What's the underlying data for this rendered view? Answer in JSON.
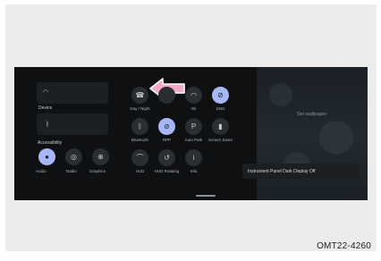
{
  "screen": {
    "left_tiles": [
      {
        "label": "",
        "icon": "wifi-icon"
      },
      {
        "label": "Device",
        "icon": "bluetooth-icon"
      }
    ],
    "section_label": "Accessibility",
    "bottom_row": [
      {
        "label": "Audio",
        "icon": "mic-icon",
        "active": true
      },
      {
        "label": "Radio",
        "icon": "radio-icon",
        "active": false
      },
      {
        "label": "Graphics",
        "icon": "game-icon",
        "active": false
      }
    ],
    "quick_grid": [
      {
        "label": "Day / Night",
        "icon": "phone-icon",
        "active": false
      },
      {
        "label": "",
        "icon": "blank-icon",
        "active": false
      },
      {
        "label": "Wi",
        "icon": "wifi-icon",
        "active": false
      },
      {
        "label": "DND",
        "icon": "dnd-icon",
        "active": true
      },
      {
        "label": "Bluetooth",
        "icon": "bluetooth-icon",
        "active": false
      },
      {
        "label": "RPP",
        "icon": "dnd-icon",
        "active": true
      },
      {
        "label": "Auto Park",
        "icon": "park-icon",
        "active": false
      },
      {
        "label": "Screen Saver",
        "icon": "lock-icon",
        "active": false
      },
      {
        "label": "HUD",
        "icon": "hud-icon",
        "active": false
      },
      {
        "label": "HUD Rotating",
        "icon": "hud-rotate-icon",
        "active": false
      },
      {
        "label": "Info",
        "icon": "info-icon",
        "active": false
      }
    ],
    "right_panel": {
      "top_text": "Set wallpaper",
      "banner_text": "Instrument Panel Dark Display Off"
    }
  },
  "annotation": {
    "arrow_color": "#f4a9c4"
  },
  "footer": {
    "code": "OMT22-4260"
  }
}
